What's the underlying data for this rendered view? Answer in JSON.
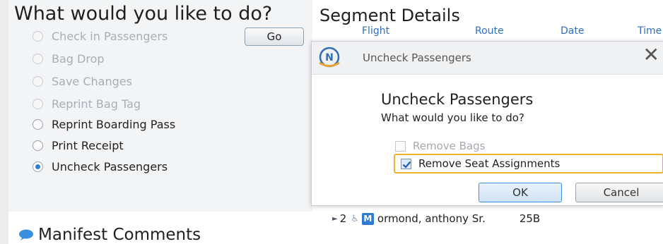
{
  "left": {
    "title": "What would you like to do?",
    "go_label": "Go",
    "options": [
      {
        "label": "Check in Passengers",
        "enabled": false,
        "selected": false
      },
      {
        "label": "Bag Drop",
        "enabled": false,
        "selected": false
      },
      {
        "label": "Save Changes",
        "enabled": false,
        "selected": false
      },
      {
        "label": "Reprint Bag Tag",
        "enabled": false,
        "selected": false
      },
      {
        "label": "Reprint Boarding Pass",
        "enabled": true,
        "selected": false
      },
      {
        "label": "Print Receipt",
        "enabled": true,
        "selected": false
      },
      {
        "label": "Uncheck Passengers",
        "enabled": true,
        "selected": true
      }
    ]
  },
  "segment": {
    "title": "Segment Details",
    "columns": [
      "Flight",
      "Route",
      "Date",
      "Time"
    ]
  },
  "dialog": {
    "window_title": "Uncheck Passengers",
    "close_glyph": "✕",
    "heading": "Uncheck Passengers",
    "question": "What would you like to do?",
    "checkboxes": [
      {
        "label": "Remove Bags",
        "checked": false,
        "enabled": false
      },
      {
        "label": "Remove Seat Assignments",
        "checked": true,
        "enabled": true
      }
    ],
    "ok_label": "OK",
    "cancel_label": "Cancel"
  },
  "passenger_row": {
    "index": "2",
    "badge": "M",
    "name": "ormond, anthony Sr.",
    "seat": "25B"
  },
  "manifest": {
    "title": "Manifest Comments"
  },
  "colors": {
    "accent_blue": "#2e6fc5",
    "focus_outline": "#f0b22b",
    "disabled_text": "#a9adb5"
  }
}
